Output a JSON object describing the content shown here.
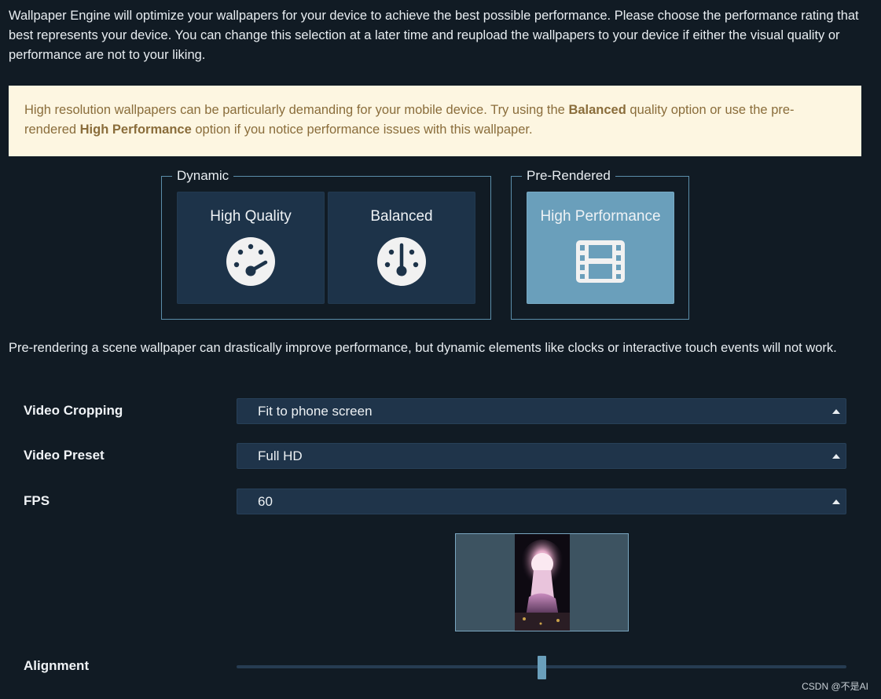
{
  "intro_text": "Wallpaper Engine will optimize your wallpapers for your device to achieve the best possible performance. Please choose the performance rating that best represents your device. You can change this selection at a later time and reupload the wallpapers to your device if either the visual quality or performance are not to your liking.",
  "warning": {
    "part1": "High resolution wallpapers can be particularly demanding for your mobile device. Try using the ",
    "bold1": "Balanced",
    "part2": " quality option or use the pre-rendered ",
    "bold2": "High Performance",
    "part3": " option if you notice performance issues with this wallpaper."
  },
  "groups": {
    "dynamic": "Dynamic",
    "prerendered": "Pre-Rendered"
  },
  "quality_options": {
    "high_quality": {
      "label": "High Quality",
      "icon": "gauge-high-icon"
    },
    "balanced": {
      "label": "Balanced",
      "icon": "gauge-mid-icon"
    },
    "high_performance": {
      "label": "High Performance",
      "icon": "film-icon",
      "selected": true
    }
  },
  "prerender_note": "Pre-rendering a scene wallpaper can drastically improve performance, but dynamic elements like clocks or interactive touch events will not work.",
  "settings": {
    "video_cropping": {
      "label": "Video Cropping",
      "value": "Fit to phone screen"
    },
    "video_preset": {
      "label": "Video Preset",
      "value": "Full HD"
    },
    "fps": {
      "label": "FPS",
      "value": "60"
    },
    "alignment": {
      "label": "Alignment",
      "value_fraction": 0.5
    }
  },
  "watermark": "CSDN @不是AI",
  "colors": {
    "background": "#111b24",
    "warning_bg": "#fdf6e1",
    "warning_text": "#8a6d3b",
    "accent": "#6a9fbb",
    "button_bg": "#1d3349"
  }
}
